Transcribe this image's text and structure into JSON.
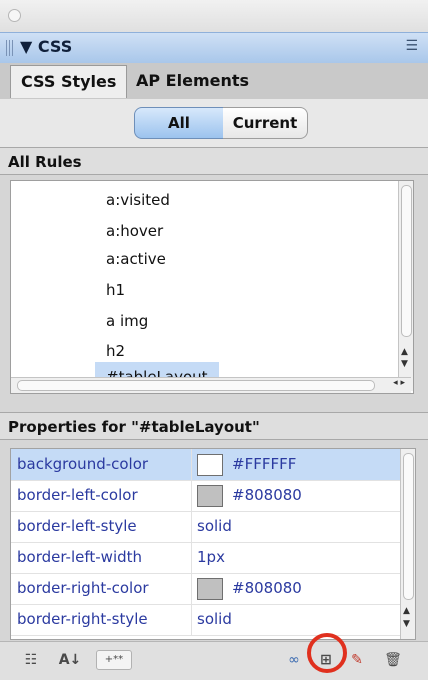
{
  "panel": {
    "title": "▼ CSS"
  },
  "tabs": [
    {
      "label": "CSS Styles"
    },
    {
      "label": "AP Elements"
    }
  ],
  "mode": {
    "all_label": "All",
    "current_label": "Current",
    "selected": "All"
  },
  "all_rules": {
    "header": "All Rules",
    "items": [
      {
        "label": "a:visited"
      },
      {
        "label": "a:hover"
      },
      {
        "label": "a:active"
      },
      {
        "label": "h1"
      },
      {
        "label": "a img"
      },
      {
        "label": "h2"
      },
      {
        "label": "#tableLayout",
        "selected": true
      }
    ]
  },
  "properties": {
    "header": "Properties for \"#tableLayout\"",
    "rows": [
      {
        "name": "background-color",
        "value": "#FFFFFF",
        "swatch": "#FFFFFF",
        "selected": true
      },
      {
        "name": "border-left-color",
        "value": "#808080",
        "swatch": "#C0C0C0"
      },
      {
        "name": "border-left-style",
        "value": "solid"
      },
      {
        "name": "border-left-width",
        "value": "1px"
      },
      {
        "name": "border-right-color",
        "value": "#808080",
        "swatch": "#C0C0C0"
      },
      {
        "name": "border-right-style",
        "value": "solid"
      }
    ]
  },
  "toolbar": {
    "show_category_icon": "category-view-icon",
    "alpha_icon": "az-sort-icon",
    "set_props_icon": "set-properties-icon",
    "attach_icon": "attach-style-sheet-icon",
    "new_rule_icon": "new-css-rule-icon",
    "edit_icon": "edit-style-icon",
    "delete_icon": "trash-icon"
  },
  "colors": {
    "accent": "#A9C7EA",
    "selection": "#C5DBF6",
    "highlight_ring": "#E0301E"
  }
}
